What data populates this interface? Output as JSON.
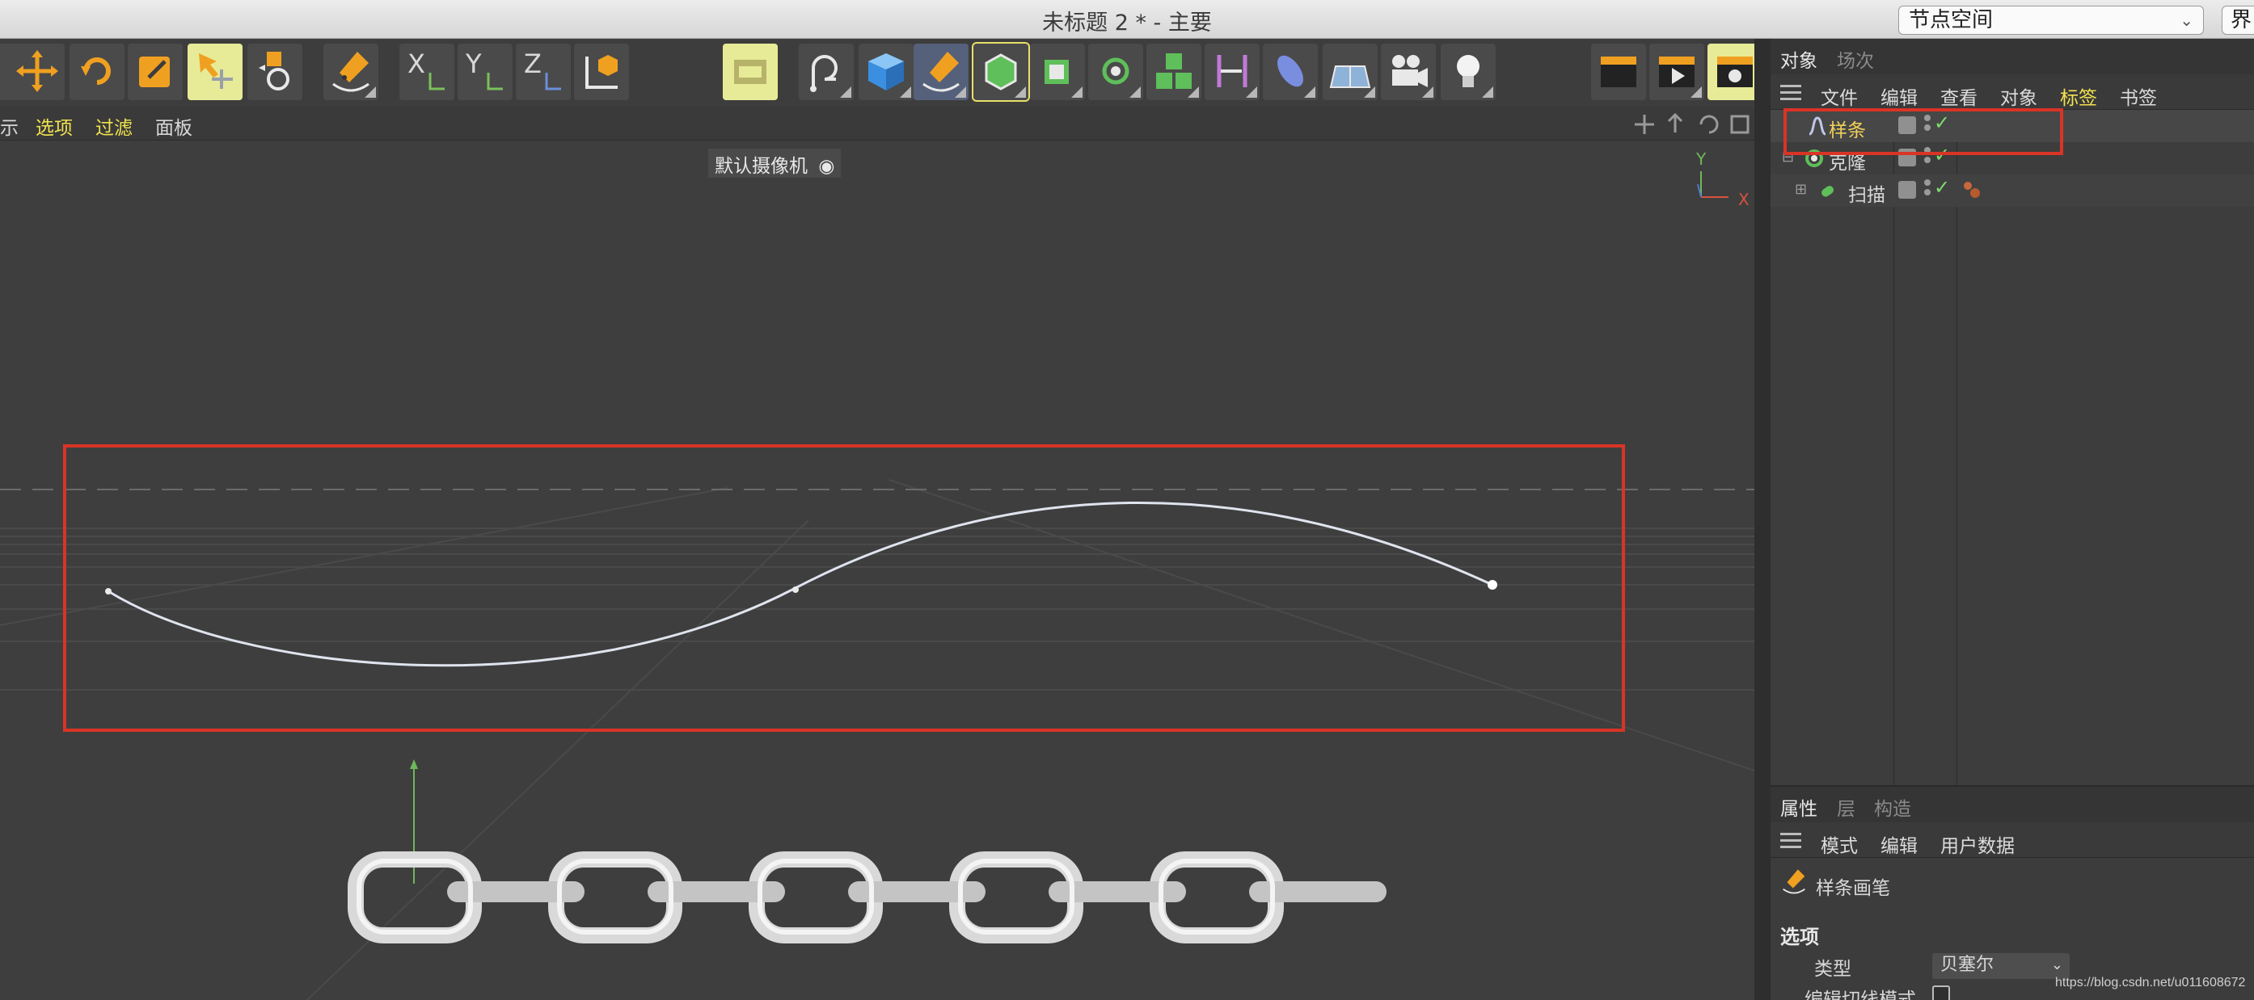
{
  "window": {
    "title": "未标题 2 * - 主要",
    "layout_select": "节点空间",
    "interface_button": "界"
  },
  "toolbar": {
    "axis_x": "X",
    "axis_y": "Y",
    "axis_z": "Z"
  },
  "viewport": {
    "menu": [
      "示",
      "选项",
      "过滤",
      "面板"
    ],
    "camera_label": "默认摄像机",
    "axis_y_label": "Y",
    "axis_x_label": "X",
    "colors": {
      "menu_highlight": "#f2e34f",
      "spline": "#dfe4ee",
      "red_box": "#d93426"
    }
  },
  "object_manager": {
    "tabs": [
      "对象",
      "场次"
    ],
    "menu": [
      "文件",
      "编辑",
      "查看",
      "对象",
      "标签",
      "书签"
    ],
    "objects": [
      {
        "name": "样条",
        "icon": "spline-icon",
        "selected": true
      },
      {
        "name": "克隆",
        "icon": "cloner-icon",
        "selected": false
      },
      {
        "name": "扫描",
        "icon": "sweep-icon",
        "selected": false
      }
    ]
  },
  "attributes": {
    "tabs": [
      "属性",
      "层",
      "构造"
    ],
    "menu": [
      "模式",
      "编辑",
      "用户数据"
    ],
    "object_title": "样条画笔",
    "section": "选项",
    "type_label": "类型",
    "type_value": "贝塞尔",
    "edit_tangent_label": "编辑切线模式"
  },
  "watermark": "https://blog.csdn.net/u011608672"
}
